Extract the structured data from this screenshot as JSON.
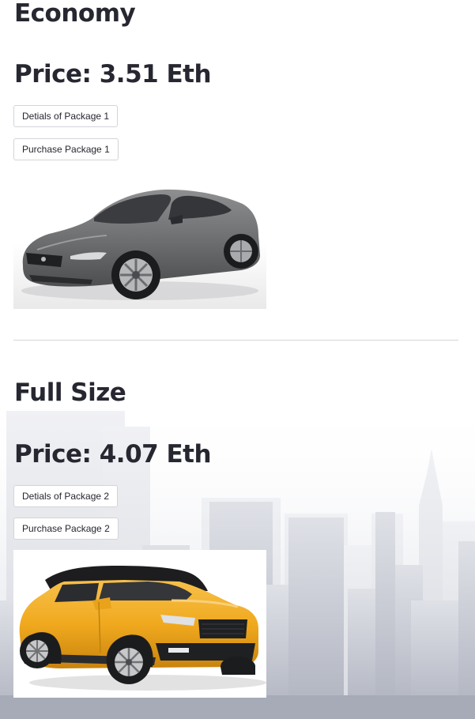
{
  "packages": [
    {
      "name": "Economy",
      "price": "Price: 3.51 Eth",
      "details_label": "Detials of Package 1",
      "purchase_label": "Purchase Package 1",
      "image": "gray-coupe-car",
      "car_color": "#6f7072"
    },
    {
      "name": "Full Size",
      "price": "Price: 4.07 Eth",
      "details_label": "Detials of Package 2",
      "purchase_label": "Purchase Package 2",
      "image": "yellow-suv-car",
      "car_color": "#f0a91e"
    }
  ],
  "colors": {
    "text": "#262730",
    "button_border": "#d3d4d8",
    "divider": "#d6d6d9",
    "background_skyline": "#b9bcc6"
  }
}
